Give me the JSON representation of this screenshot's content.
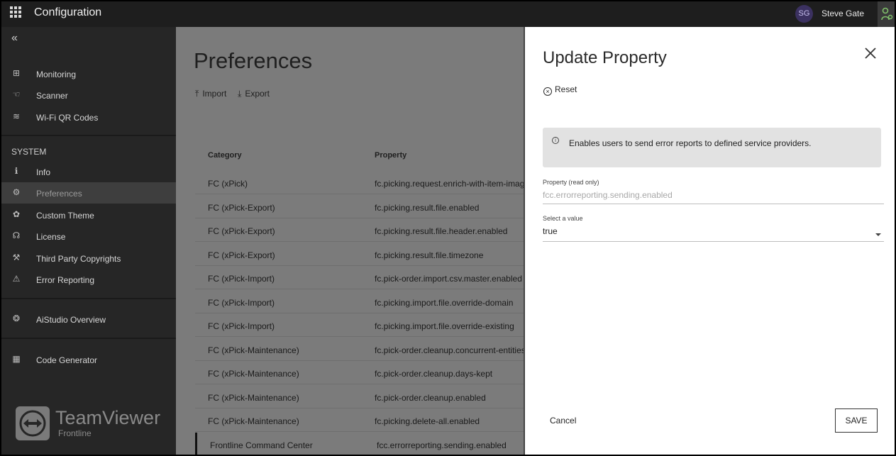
{
  "topbar": {
    "title": "Configuration",
    "user_initials": "SG",
    "user_name": "Steve Gate"
  },
  "sidebar": {
    "items_top": [
      {
        "label": "Monitoring",
        "icon": "dashboard-icon"
      },
      {
        "label": "Scanner",
        "icon": "scanner-icon"
      },
      {
        "label": "Wi-Fi QR Codes",
        "icon": "wifi-icon"
      }
    ],
    "system_label": "SYSTEM",
    "items_system": [
      {
        "label": "Info",
        "icon": "info-icon"
      },
      {
        "label": "Preferences",
        "icon": "gear-icon"
      },
      {
        "label": "Custom Theme",
        "icon": "palette-icon"
      },
      {
        "label": "License",
        "icon": "license-icon"
      },
      {
        "label": "Third Party Copyrights",
        "icon": "hammer-icon"
      },
      {
        "label": "Error Reporting",
        "icon": "warning-icon"
      }
    ],
    "items_bottom": [
      {
        "label": "AiStudio Overview",
        "icon": "brain-icon"
      },
      {
        "label": "Code Generator",
        "icon": "qr-code-icon"
      }
    ],
    "brand_name": "TeamViewer",
    "brand_sub": "Frontline"
  },
  "main": {
    "title": "Preferences",
    "import_label": "Import",
    "export_label": "Export",
    "columns": [
      "Category",
      "Property"
    ],
    "rows": [
      {
        "category": "FC (xPick)",
        "property": "fc.picking.request.enrich-with-item-image"
      },
      {
        "category": "FC (xPick-Export)",
        "property": "fc.picking.result.file.enabled"
      },
      {
        "category": "FC (xPick-Export)",
        "property": "fc.picking.result.file.header.enabled"
      },
      {
        "category": "FC (xPick-Export)",
        "property": "fc.picking.result.file.timezone"
      },
      {
        "category": "FC (xPick-Import)",
        "property": "fc.pick-order.import.csv.master.enabled"
      },
      {
        "category": "FC (xPick-Import)",
        "property": "fc.picking.import.file.override-domain"
      },
      {
        "category": "FC (xPick-Import)",
        "property": "fc.picking.import.file.override-existing"
      },
      {
        "category": "FC (xPick-Maintenance)",
        "property": "fc.pick-order.cleanup.concurrent-entities"
      },
      {
        "category": "FC (xPick-Maintenance)",
        "property": "fc.pick-order.cleanup.days-kept"
      },
      {
        "category": "FC (xPick-Maintenance)",
        "property": "fc.pick-order.cleanup.enabled"
      },
      {
        "category": "FC (xPick-Maintenance)",
        "property": "fc.picking.delete-all.enabled"
      },
      {
        "category": "Frontline Command Center",
        "property": "fcc.errorreporting.sending.enabled"
      }
    ]
  },
  "panel": {
    "title": "Update Property",
    "reset_label": "Reset",
    "info_text": "Enables users to send error reports to defined service providers.",
    "property_label": "Property (read only)",
    "property_value": "fcc.errorreporting.sending.enabled",
    "select_label": "Select a value",
    "select_value": "true",
    "cancel_label": "Cancel",
    "save_label": "SAVE"
  }
}
